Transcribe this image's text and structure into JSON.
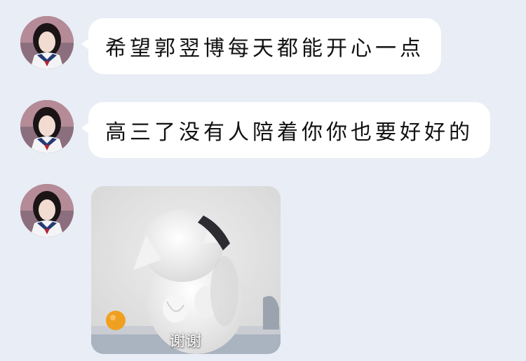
{
  "chat": {
    "messages": [
      {
        "type": "text",
        "text": "希望郭翌博每天都能开心一点"
      },
      {
        "type": "text",
        "text": "高三了没有人陪着你你也要好好的"
      },
      {
        "type": "sticker",
        "caption": "谢谢",
        "sticker_name": "white-cat-sticker"
      }
    ]
  },
  "colors": {
    "background": "#e9edf5",
    "bubble": "#ffffff",
    "text": "#111111"
  }
}
